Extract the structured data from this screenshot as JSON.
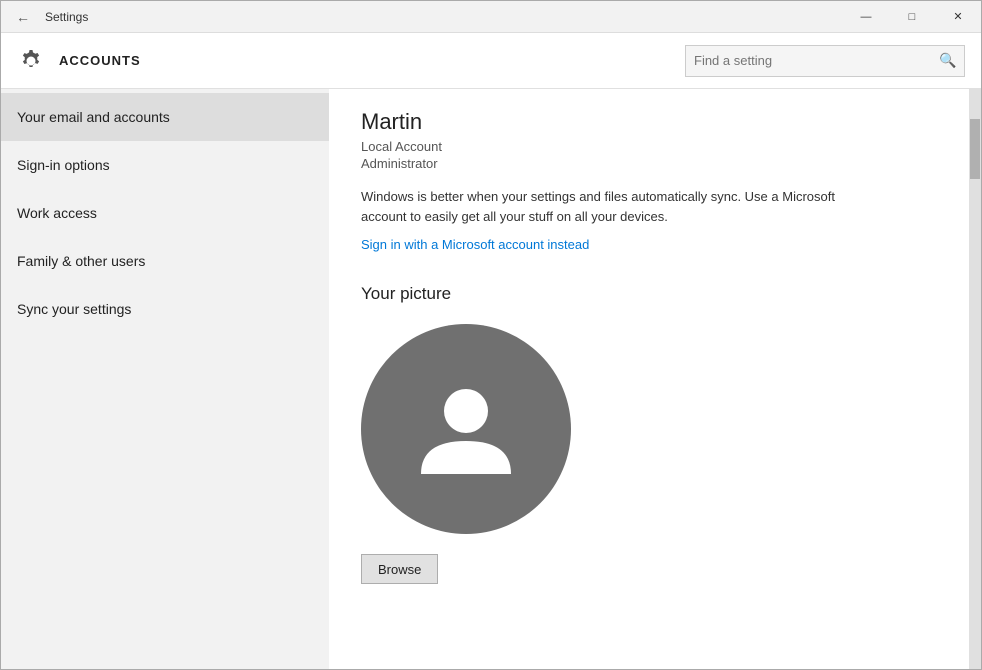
{
  "window": {
    "title": "Settings",
    "controls": {
      "minimize": "—",
      "maximize": "□",
      "close": "✕"
    }
  },
  "header": {
    "icon": "gear",
    "title": "ACCOUNTS",
    "search_placeholder": "Find a setting"
  },
  "sidebar": {
    "items": [
      {
        "id": "email-accounts",
        "label": "Your email and accounts",
        "active": true
      },
      {
        "id": "sign-in-options",
        "label": "Sign-in options",
        "active": false
      },
      {
        "id": "work-access",
        "label": "Work access",
        "active": false
      },
      {
        "id": "family-users",
        "label": "Family & other users",
        "active": false
      },
      {
        "id": "sync-settings",
        "label": "Sync your settings",
        "active": false
      }
    ]
  },
  "main": {
    "user": {
      "name": "Martin",
      "account_type": "Local Account",
      "role": "Administrator"
    },
    "sync_message": "Windows is better when your settings and files automatically sync. Use a Microsoft account to easily get all your stuff on all your devices.",
    "ms_account_link": "Sign in with a Microsoft account instead",
    "picture_section": {
      "title": "Your picture",
      "browse_label": "Browse"
    }
  }
}
